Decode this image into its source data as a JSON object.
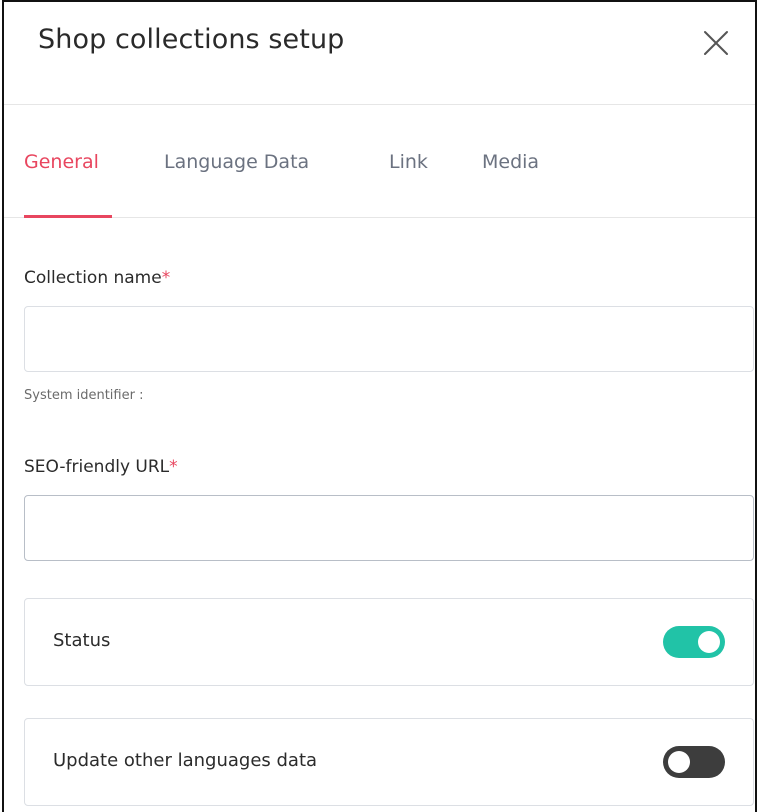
{
  "dialog": {
    "title": "Shop collections setup",
    "close_icon": "close-icon"
  },
  "tabs": [
    {
      "label": "General",
      "active": true
    },
    {
      "label": "Language Data",
      "active": false
    },
    {
      "label": "Link",
      "active": false
    },
    {
      "label": "Media",
      "active": false
    }
  ],
  "form": {
    "collection_name": {
      "label": "Collection name",
      "required_mark": "*",
      "value": "",
      "placeholder": ""
    },
    "system_identifier": {
      "label": "System identifier :"
    },
    "seo_url": {
      "label": "SEO-friendly URL",
      "required_mark": "*",
      "value": "",
      "placeholder": ""
    },
    "status": {
      "label": "Status",
      "enabled": true
    },
    "update_languages": {
      "label": "Update other languages data",
      "enabled": false
    }
  },
  "colors": {
    "accent": "#e8465f",
    "toggle_on": "#21c3a7",
    "toggle_off": "#3d3d3d",
    "border": "#dcdfe4"
  }
}
